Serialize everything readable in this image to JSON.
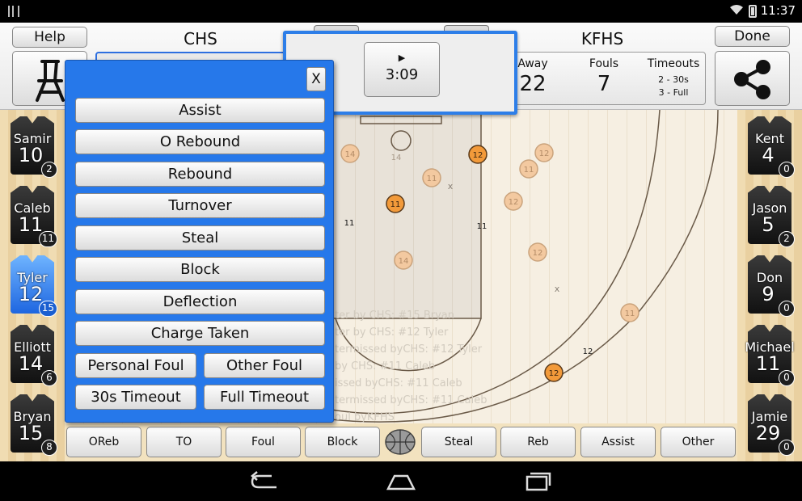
{
  "status_bar": {
    "time": "11:37"
  },
  "header": {
    "help_label": "Help",
    "done_label": "Done",
    "home_team": "CHS",
    "away_team": "KFHS",
    "stats": {
      "away_label": "Away",
      "away_value": "22",
      "fouls_label": "Fouls",
      "fouls_value": "7",
      "timeouts_label": "Timeouts",
      "timeouts_30s": "2 - 30s",
      "timeouts_full": "3 - Full"
    }
  },
  "timer": {
    "play_symbol": "▶",
    "time": "3:09"
  },
  "dialog": {
    "close_label": "X",
    "buttons": [
      "Assist",
      "O Rebound",
      "Rebound",
      "Turnover",
      "Steal",
      "Block",
      "Deflection",
      "Charge Taken"
    ],
    "pair1": [
      "Personal Foul",
      "Other Foul"
    ],
    "pair2": [
      "30s Timeout",
      "Full Timeout"
    ]
  },
  "home_roster": [
    {
      "name": "Samir",
      "number": "10",
      "count": "2",
      "active": false
    },
    {
      "name": "Caleb",
      "number": "11",
      "count": "11",
      "active": false
    },
    {
      "name": "Tyler",
      "number": "12",
      "count": "15",
      "active": true
    },
    {
      "name": "Elliott",
      "number": "14",
      "count": "6",
      "active": false
    },
    {
      "name": "Bryan",
      "number": "15",
      "count": "8",
      "active": false
    }
  ],
  "away_roster": [
    {
      "name": "Kent",
      "number": "4",
      "count": "0"
    },
    {
      "name": "Jason",
      "number": "5",
      "count": "2"
    },
    {
      "name": "Don",
      "number": "9",
      "count": "0"
    },
    {
      "name": "Michael",
      "number": "11",
      "count": "0"
    },
    {
      "name": "Jamie",
      "number": "29",
      "count": "0"
    }
  ],
  "court": {
    "shot_markers": [
      {
        "label": "14",
        "style": "faded"
      },
      {
        "label": "12",
        "style": "orange"
      },
      {
        "label": "12",
        "style": "faded"
      },
      {
        "label": "11",
        "style": "faded"
      },
      {
        "label": "11",
        "style": "faded"
      },
      {
        "label": "11",
        "style": "orange"
      },
      {
        "label": "12",
        "style": "faded"
      },
      {
        "label": "12",
        "style": "faded"
      },
      {
        "label": "14",
        "style": "faded"
      },
      {
        "label": "11",
        "style": "faded"
      },
      {
        "label": "12",
        "style": "orange"
      }
    ],
    "text_marks": [
      "14",
      "11",
      "11",
      "12"
    ],
    "miss_marks": [
      "x",
      "x"
    ],
    "log_lines": [
      "ter by CHS: #15 Bryan",
      "ter by CHS: #12 Tyler",
      "termissed byCHS: #12 Tyler",
      "by CHS: #11 Caleb",
      "issed byCHS: #11 Caleb",
      "termissed byCHS: #11 Caleb",
      "oul byKFHS"
    ],
    "colors": {
      "orange": "#f29a3a",
      "faded": "#f3c9a0"
    }
  },
  "bottom_bar": {
    "buttons_left": [
      "OReb",
      "TO",
      "Foul",
      "Block"
    ],
    "buttons_right": [
      "Steal",
      "Reb",
      "Assist",
      "Other"
    ]
  }
}
